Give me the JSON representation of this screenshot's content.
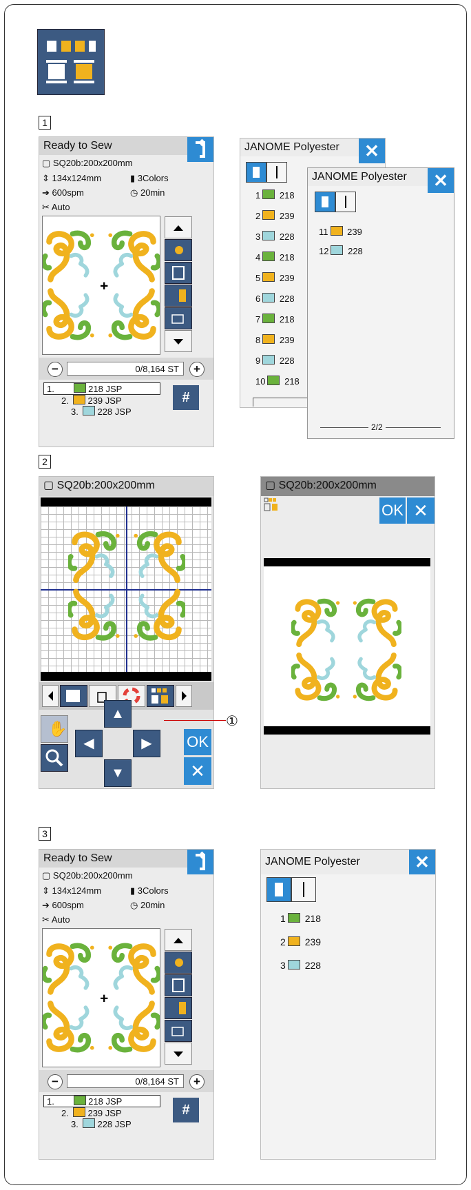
{
  "steps": [
    "1",
    "2",
    "3"
  ],
  "colors": {
    "green": "#6ab23c",
    "gold": "#f0b21e",
    "aqua": "#9fd6dc",
    "blue": "#2e8bd3",
    "navy": "#3c5a82"
  },
  "ready_screen": {
    "title": "Ready to Sew",
    "hoop": "SQ20b:200x200mm",
    "size": "134x124mm",
    "colors_count": "3Colors",
    "speed": "600spm",
    "time": "20min",
    "cutter": "Auto",
    "stitch_count": "0/8,164 ST",
    "thread_list": [
      {
        "num": "1.",
        "code": "218 JSP",
        "color": "green"
      },
      {
        "num": "2.",
        "code": "239 JSP",
        "color": "gold"
      },
      {
        "num": "3.",
        "code": "228 JSP",
        "color": "aqua"
      }
    ],
    "hash_label": "#"
  },
  "thread_popup": {
    "title": "JANOME Polyester",
    "page1": [
      {
        "num": "1",
        "code": "218",
        "color": "green"
      },
      {
        "num": "2",
        "code": "239",
        "color": "gold"
      },
      {
        "num": "3",
        "code": "228",
        "color": "aqua"
      },
      {
        "num": "4",
        "code": "218",
        "color": "green"
      },
      {
        "num": "5",
        "code": "239",
        "color": "gold"
      },
      {
        "num": "6",
        "code": "228",
        "color": "aqua"
      },
      {
        "num": "7",
        "code": "218",
        "color": "green"
      },
      {
        "num": "8",
        "code": "239",
        "color": "gold"
      },
      {
        "num": "9",
        "code": "228",
        "color": "aqua"
      },
      {
        "num": "10",
        "code": "218",
        "color": "green"
      }
    ],
    "page2": [
      {
        "num": "11",
        "code": "239",
        "color": "gold"
      },
      {
        "num": "12",
        "code": "228",
        "color": "aqua"
      }
    ],
    "page_indicator": "2/2"
  },
  "edit_screen": {
    "hoop": "SQ20b:200x200mm",
    "ok_label": "OK",
    "callout": "①"
  },
  "grouping_screen": {
    "hoop": "SQ20b:200x200mm",
    "ok_label": "OK"
  },
  "final_popup": {
    "title": "JANOME Polyester",
    "rows": [
      {
        "num": "1",
        "code": "218",
        "color": "green"
      },
      {
        "num": "2",
        "code": "239",
        "color": "gold"
      },
      {
        "num": "3",
        "code": "228",
        "color": "aqua"
      }
    ]
  }
}
